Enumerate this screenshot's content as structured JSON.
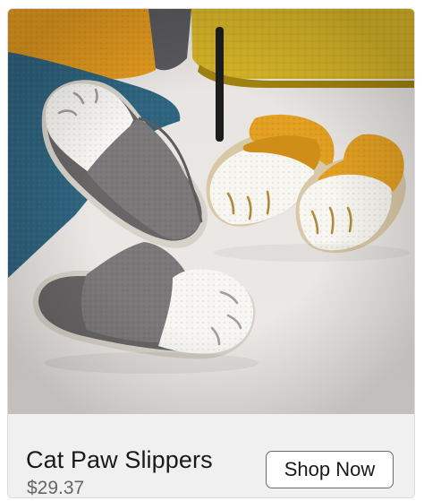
{
  "product": {
    "title": "Cat Paw Slippers",
    "price": "$29.37",
    "cta_label": "Shop Now",
    "image_subject": "grey-and-white and orange-and-white fluffy cat paw slippers on a carpet"
  },
  "colors": {
    "card_background": "#f0f0f0",
    "button_background": "#ffffff",
    "button_border": "#6b6b6b",
    "title_text": "#1a1a1a",
    "price_text": "#666666"
  }
}
